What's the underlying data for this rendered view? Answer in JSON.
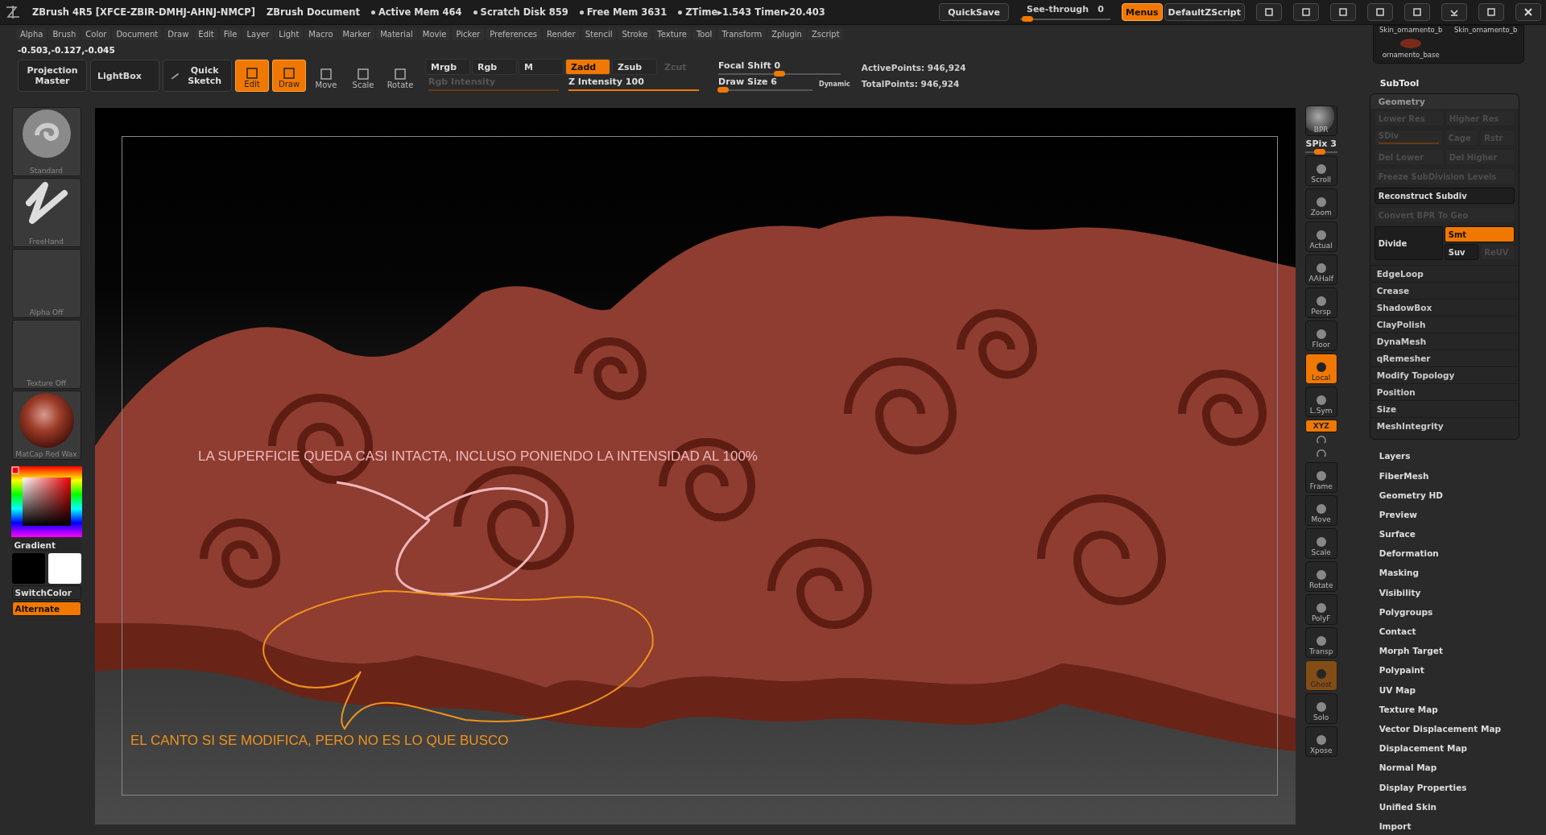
{
  "title_bar": {
    "app": "ZBrush 4R5 [XFCE-ZBIR-DMHJ-AHNJ-NMCP]",
    "document": "ZBrush Document",
    "stats": [
      "Active Mem 464",
      "Scratch Disk 859",
      "Free Mem 3631",
      "ZTime▸1.543 Timer▸20.403"
    ],
    "quicksave": "QuickSave",
    "see_through": {
      "label": "See-through",
      "value": "0",
      "level": 0.08
    },
    "menus": {
      "label": "Menus",
      "on": true
    },
    "script": "DefaultZScript"
  },
  "menu": [
    "Alpha",
    "Brush",
    "Color",
    "Document",
    "Draw",
    "Edit",
    "File",
    "Layer",
    "Light",
    "Macro",
    "Marker",
    "Material",
    "Movie",
    "Picker",
    "Preferences",
    "Render",
    "Stencil",
    "Stroke",
    "Texture",
    "Tool",
    "Transform",
    "Zplugin",
    "Zscript"
  ],
  "coordinates": "-0.503,-0.127,-0.045",
  "toolbar": {
    "projection_master": "Projection Master",
    "lightbox": "LightBox",
    "quick_sketch": "Quick Sketch",
    "modes": [
      {
        "label": "Edit",
        "on": true
      },
      {
        "label": "Draw",
        "on": true
      },
      {
        "label": "Move",
        "on": false
      },
      {
        "label": "Scale",
        "on": false
      },
      {
        "label": "Rotate",
        "on": false
      }
    ],
    "channels": [
      {
        "label": "Mrgb",
        "on": false,
        "disabled": false
      },
      {
        "label": "Rgb",
        "on": false,
        "disabled": false
      },
      {
        "label": "M",
        "on": false,
        "disabled": false
      },
      {
        "label": "Zadd",
        "on": true,
        "disabled": false
      },
      {
        "label": "Zsub",
        "on": false,
        "disabled": false
      },
      {
        "label": "Zcut",
        "on": false,
        "disabled": true
      }
    ],
    "rgb_intensity": {
      "label": "Rgb Intensity",
      "disabled": true,
      "level": 1
    },
    "z_intensity": {
      "label": "Z Intensity 100",
      "disabled": false,
      "level": 1
    },
    "focal_shift": {
      "label": "Focal Shift 0",
      "level": 0.5
    },
    "draw_size": {
      "label": "Draw Size 6",
      "level": 0.05
    },
    "dynamic": "Dynamic",
    "active_points": "ActivePoints: 946,924",
    "total_points": "TotalPoints: 946,924"
  },
  "subtools": [
    "Skin_ornamento_b",
    "Skin_ornamento_b",
    "ornamento_base"
  ],
  "shelf": {
    "brush": "Standard",
    "stroke": "FreeHand",
    "alpha": "Alpha Off",
    "texture": "Texture Off",
    "material": "MatCap Red Wax",
    "gradient": "Gradient",
    "switch_color": "SwitchColor",
    "alternate": {
      "label": "Alternate",
      "on": true
    }
  },
  "annotations": [
    {
      "text": "LA SUPERFICIE QUEDA CASI INTACTA, INCLUSO PONIENDO LA INTENSIDAD AL 100%",
      "color": "#f2b8bc"
    },
    {
      "text": "EL CANTO SI SE MODIFICA, PERO NO ES LO QUE BUSCO",
      "color": "#f0921e"
    }
  ],
  "right_shelf": [
    {
      "kind": "bpr",
      "label": "BPR"
    },
    {
      "kind": "slider",
      "label": "SPix 3",
      "level": 0.45
    },
    {
      "kind": "button",
      "label": "Scroll",
      "on": false,
      "disabled": false
    },
    {
      "kind": "button",
      "label": "Zoom",
      "on": false,
      "disabled": false
    },
    {
      "kind": "button",
      "label": "Actual",
      "on": false,
      "disabled": false
    },
    {
      "kind": "button",
      "label": "AAHalf",
      "on": false,
      "disabled": false
    },
    {
      "kind": "button",
      "label": "Persp",
      "on": false,
      "disabled": false
    },
    {
      "kind": "button",
      "label": "Floor",
      "on": false,
      "disabled": false
    },
    {
      "kind": "button",
      "label": "Local",
      "on": true,
      "disabled": false
    },
    {
      "kind": "button",
      "label": "L.Sym",
      "on": false,
      "disabled": false
    },
    {
      "kind": "small",
      "label": "XYZ",
      "on": true
    },
    {
      "kind": "mini"
    },
    {
      "kind": "mini"
    },
    {
      "kind": "button",
      "label": "Frame",
      "on": false,
      "disabled": false
    },
    {
      "kind": "button",
      "label": "Move",
      "on": false,
      "disabled": false
    },
    {
      "kind": "button",
      "label": "Scale",
      "on": false,
      "disabled": false
    },
    {
      "kind": "button",
      "label": "Rotate",
      "on": false,
      "disabled": false
    },
    {
      "kind": "button",
      "label": "PolyF",
      "on": false,
      "disabled": false
    },
    {
      "kind": "button",
      "label": "Transp",
      "on": false,
      "disabled": false
    },
    {
      "kind": "button",
      "label": "Ghost",
      "on": true,
      "disabled": true
    },
    {
      "kind": "button",
      "label": "Solo",
      "on": false,
      "disabled": false
    },
    {
      "kind": "button",
      "label": "Xpose",
      "on": false,
      "disabled": false
    }
  ],
  "subtool_header": "SubTool",
  "geometry": {
    "title": "Geometry",
    "rows": [
      {
        "kind": "pair",
        "items": [
          {
            "kind": "button",
            "label": "Lower Res",
            "disabled": true
          },
          {
            "kind": "button",
            "label": "Higher Res",
            "disabled": true
          }
        ]
      },
      {
        "kind": "triple",
        "items": [
          {
            "kind": "slider",
            "label": "SDiv",
            "disabled": true,
            "level": 1
          },
          {
            "kind": "button",
            "label": "Cage",
            "disabled": true
          },
          {
            "kind": "button",
            "label": "Rstr",
            "disabled": true
          }
        ]
      },
      {
        "kind": "pair",
        "items": [
          {
            "kind": "button",
            "label": "Del Lower",
            "disabled": true
          },
          {
            "kind": "button",
            "label": "Del Higher",
            "disabled": true
          }
        ]
      },
      {
        "kind": "full",
        "items": [
          {
            "kind": "button",
            "label": "Freeze SubDivision Levels",
            "disabled": true
          }
        ]
      },
      {
        "kind": "full",
        "items": [
          {
            "kind": "button",
            "label": "Reconstruct Subdiv",
            "disabled": false
          }
        ]
      },
      {
        "kind": "full",
        "items": [
          {
            "kind": "button",
            "label": "Convert BPR To Geo",
            "disabled": true
          }
        ]
      },
      {
        "kind": "divide",
        "items": [
          {
            "kind": "button",
            "label": "Divide",
            "disabled": false
          },
          {
            "kind": "toggle",
            "label": "Smt",
            "disabled": false,
            "on": true
          },
          {
            "kind": "button",
            "label": "Suv",
            "disabled": false
          },
          {
            "kind": "button",
            "label": "ReUV",
            "disabled": true
          }
        ]
      }
    ],
    "sections": [
      "EdgeLoop",
      "Crease",
      "ShadowBox",
      "ClayPolish",
      "DynaMesh",
      "qRemesher",
      "Modify Topology",
      "Position",
      "Size",
      "MeshIntegrity"
    ]
  },
  "tool_sections": [
    "Layers",
    "FiberMesh",
    "Geometry HD",
    "Preview",
    "Surface",
    "Deformation",
    "Masking",
    "Visibility",
    "Polygroups",
    "Contact",
    "Morph Target",
    "Polypaint",
    "UV Map",
    "Texture Map",
    "Vector Displacement Map",
    "Displacement Map",
    "Normal Map",
    "Display Properties",
    "Unified Skin",
    "Import"
  ]
}
